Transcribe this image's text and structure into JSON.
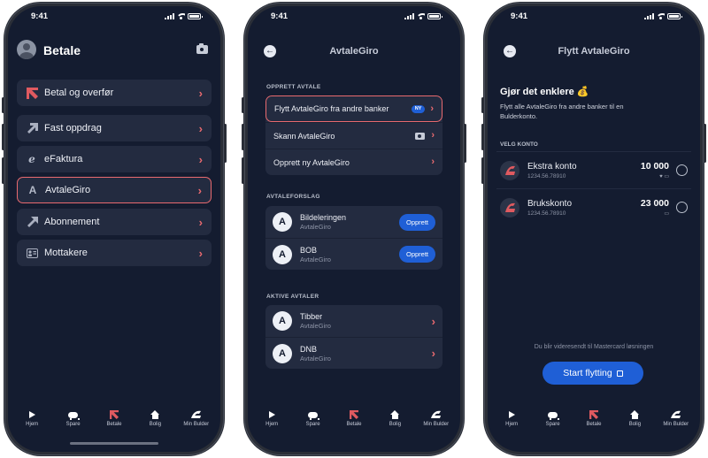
{
  "status": {
    "time": "9:41"
  },
  "colors": {
    "accent_red": "#e96a6f",
    "primary_blue": "#1f5fd6",
    "screen_bg": "#141c30",
    "card_bg": "#232b40"
  },
  "screen1": {
    "title": "Betale",
    "menu": [
      {
        "label": "Betal og overfør",
        "icon": "send-arrow-icon"
      },
      {
        "label": "Fast oppdrag",
        "icon": "repeat-arrow-icon"
      },
      {
        "label": "eFaktura",
        "icon": "efaktura-icon"
      },
      {
        "label": "AvtaleGiro",
        "icon": "avtalegiro-icon",
        "active": true
      },
      {
        "label": "Abonnement",
        "icon": "subscription-icon"
      },
      {
        "label": "Mottakere",
        "icon": "contacts-icon"
      }
    ]
  },
  "screen2": {
    "title": "AvtaleGiro",
    "section_create": "OPPRETT AVTALE",
    "create_rows": [
      {
        "label": "Flytt AvtaleGiro fra andre banker",
        "badge": "NY"
      },
      {
        "label": "Skann AvtaleGiro"
      },
      {
        "label": "Opprett ny AvtaleGiro"
      }
    ],
    "section_suggest": "AVTALEFORSLAG",
    "suggestions": [
      {
        "name": "Bildeleringen",
        "sub": "AvtaleGiro",
        "button": "Opprett"
      },
      {
        "name": "BOB",
        "sub": "AvtaleGiro",
        "button": "Opprett"
      }
    ],
    "section_active": "AKTIVE AVTALER",
    "active": [
      {
        "name": "Tibber",
        "sub": "AvtaleGiro"
      },
      {
        "name": "DNB",
        "sub": "AvtaleGiro"
      }
    ]
  },
  "screen3": {
    "title": "Flytt AvtaleGiro",
    "heading": "Gjør det enklere 💰",
    "paragraph": "Flytt alle AvtaleGiro fra andre banker til en Bulderkonto.",
    "section": "VELG KONTO",
    "accounts": [
      {
        "name": "Ekstra konto",
        "number": "1234.56.78910",
        "balance": "10 000",
        "icons": "♥ ▭"
      },
      {
        "name": "Brukskonto",
        "number": "1234.56.78910",
        "balance": "23 000",
        "icons": "▭"
      }
    ],
    "note": "Du blir videresendt til Mastercard løsningen",
    "button": "Start flytting"
  },
  "tabs": [
    {
      "label": "Hjem",
      "icon": "play-icon"
    },
    {
      "label": "Spare",
      "icon": "piggy-bank-icon"
    },
    {
      "label": "Betale",
      "icon": "send-arrow-icon"
    },
    {
      "label": "Bolig",
      "icon": "house-icon"
    },
    {
      "label": "Min Bulder",
      "icon": "bulder-logo-icon"
    }
  ]
}
